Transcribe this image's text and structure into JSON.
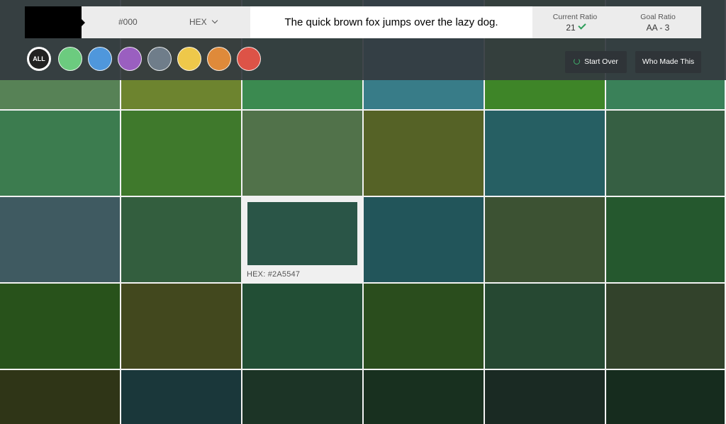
{
  "toolbar": {
    "foreground_color": "#000000",
    "hex_value": "#000",
    "format_label": "HEX",
    "preview_text": "The quick brown fox jumps over the lazy dog.",
    "current_ratio_label": "Current Ratio",
    "current_ratio_value": "21",
    "goal_ratio_label": "Goal Ratio",
    "goal_ratio_value": "AA - 3"
  },
  "filters": [
    {
      "name": "all",
      "label": "ALL",
      "color": "#222222"
    },
    {
      "name": "green",
      "label": "",
      "color": "#6ccb7f"
    },
    {
      "name": "blue",
      "label": "",
      "color": "#4f97dc"
    },
    {
      "name": "purple",
      "label": "",
      "color": "#9a5fc0"
    },
    {
      "name": "gray",
      "label": "",
      "color": "#6f7d8a"
    },
    {
      "name": "yellow",
      "label": "",
      "color": "#eec84a"
    },
    {
      "name": "orange",
      "label": "",
      "color": "#df8a3a"
    },
    {
      "name": "red",
      "label": "",
      "color": "#dd5347"
    }
  ],
  "actions": {
    "start_over": "Start Over",
    "who_made": "Who Made This"
  },
  "grid": {
    "selected": {
      "row": 2,
      "col": 2,
      "label": "HEX: #2A5547"
    },
    "rows": [
      [
        "#578256",
        "#6d842f",
        "#3b8a50",
        "#387c88",
        "#3e8528",
        "#3a8159"
      ],
      [
        "#3c7c4f",
        "#3f792c",
        "#51724a",
        "#556226",
        "#265f63",
        "#365f43"
      ],
      [
        "#3f5a61",
        "#335e3e",
        "#2a5547",
        "#22555a",
        "#3c5233",
        "#25582e"
      ],
      [
        "#28521b",
        "#42481e",
        "#224e35",
        "#2a4d1d",
        "#264832",
        "#32422b"
      ],
      [
        "#2f3517",
        "#1a373a",
        "#1c3426",
        "#18301f",
        "#1a2a23",
        "#162c1e"
      ]
    ]
  }
}
